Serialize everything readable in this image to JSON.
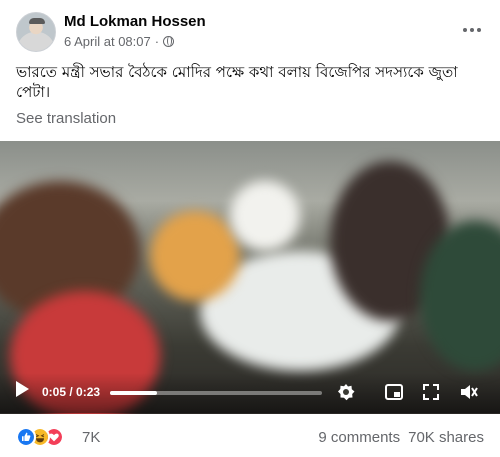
{
  "post": {
    "author": "Md Lokman Hossen",
    "date": "6 April at 08:07",
    "separator": "·",
    "privacy_icon": "globe-icon",
    "options_icon": "more-options-icon",
    "text": "ভারতে মন্ত্রী সভার বৈঠকে মোদির পক্ষে কথা বলায় বিজেপির সদস্যকে জুতা পেটা।",
    "see_translation": "See translation"
  },
  "video": {
    "current_time": "0:05",
    "duration": "0:23",
    "time_display": "0:05 / 0:23",
    "progress_fraction": 0.22,
    "controls": [
      "play-icon",
      "settings-icon",
      "picture-in-picture-icon",
      "fullscreen-icon",
      "volume-icon"
    ]
  },
  "engagement": {
    "reaction_icons": [
      "like-reaction-icon",
      "haha-reaction-icon",
      "love-reaction-icon"
    ],
    "reactions_count": "7K",
    "comments": "9 comments",
    "shares": "70K shares"
  },
  "colors": {
    "secondary_text": "#65676b",
    "like_blue": "#1877f2",
    "haha_yellow": "#f7b928",
    "love_red": "#f33e58"
  }
}
